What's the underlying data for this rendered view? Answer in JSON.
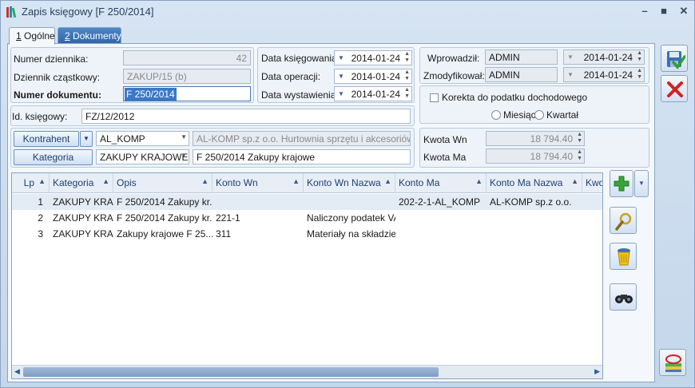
{
  "window": {
    "title": "Zapis księgowy [F 250/2014]",
    "minimize": "–",
    "maximize": "■",
    "close": "✕"
  },
  "tabs": [
    {
      "key": "1",
      "label": "Ogólne"
    },
    {
      "key": "2",
      "label": "Dokumenty"
    }
  ],
  "journal": {
    "numer_dziennika_label": "Numer dziennika:",
    "numer_dziennika_value": "42",
    "dziennik_label": "Dziennik cząstkowy:",
    "dziennik_value": "ZAKUP/15 (b)",
    "numer_dokumentu_label": "Numer dokumentu:",
    "numer_dokumentu_value": "F 250/2014"
  },
  "dates": {
    "ksiegowania_label": "Data księgowania:",
    "ksiegowania_value": "2014-01-24",
    "operacji_label": "Data operacji:",
    "operacji_value": "2014-01-24",
    "wystawienia_label": "Data wystawienia:",
    "wystawienia_value": "2014-01-24"
  },
  "audit": {
    "wprowadzil_label": "Wprowadził:",
    "wprowadzil_user": "ADMIN",
    "wprowadzil_date": "2014-01-24",
    "zmodyfikowal_label": "Zmodyfikował:",
    "zmodyfikowal_user": "ADMIN",
    "zmodyfikowal_date": "2014-01-24"
  },
  "tax": {
    "korekta_label": "Korekta do podatku dochodowego",
    "miesiac_label": "Miesiąc",
    "kwartal_label": "Kwartał"
  },
  "id_ksiegowy": {
    "label": "Id. księgowy:",
    "value": "FZ/12/2012"
  },
  "kontrahent": {
    "button": "Kontrahent",
    "code": "AL_KOMP",
    "name": "AL-KOMP sp.z o.o. Hurtownia sprzętu i akcesoriów o..."
  },
  "kategoria": {
    "button": "Kategoria",
    "code": "ZAKUPY KRAJOWE",
    "description": "F 250/2014 Zakupy krajowe"
  },
  "amounts": {
    "wn_label": "Kwota Wn",
    "wn_value": "18 794.40",
    "ma_label": "Kwota Ma",
    "ma_value": "18 794.40"
  },
  "grid": {
    "columns": [
      "Lp",
      "Kategoria",
      "Opis",
      "Konto Wn",
      "Konto Wn Nazwa",
      "Konto Ma",
      "Konto Ma Nazwa",
      "Kwo"
    ],
    "rows": [
      {
        "lp": "1",
        "kategoria": "ZAKUPY KRA...",
        "opis": "F 250/2014 Zakupy kr...",
        "konto_wn": "",
        "konto_wn_nazwa": "",
        "konto_ma": "202-2-1-AL_KOMP",
        "konto_ma_nazwa": "AL-KOMP sp.z o.o."
      },
      {
        "lp": "2",
        "kategoria": "ZAKUPY KRA...",
        "opis": "F 250/2014 Zakupy kr...",
        "konto_wn": "221-1",
        "konto_wn_nazwa": "Naliczony podatek VAT",
        "konto_ma": "",
        "konto_ma_nazwa": ""
      },
      {
        "lp": "3",
        "kategoria": "ZAKUPY KRA...",
        "opis": "Zakupy krajowe F 25...",
        "konto_wn": "311",
        "konto_wn_nazwa": "Materiały na składzie",
        "konto_ma": "",
        "konto_ma_nazwa": ""
      }
    ]
  },
  "colors": {
    "accent": "#2f64a8",
    "save_green": "#3aa33a",
    "cancel_red": "#d42020"
  }
}
